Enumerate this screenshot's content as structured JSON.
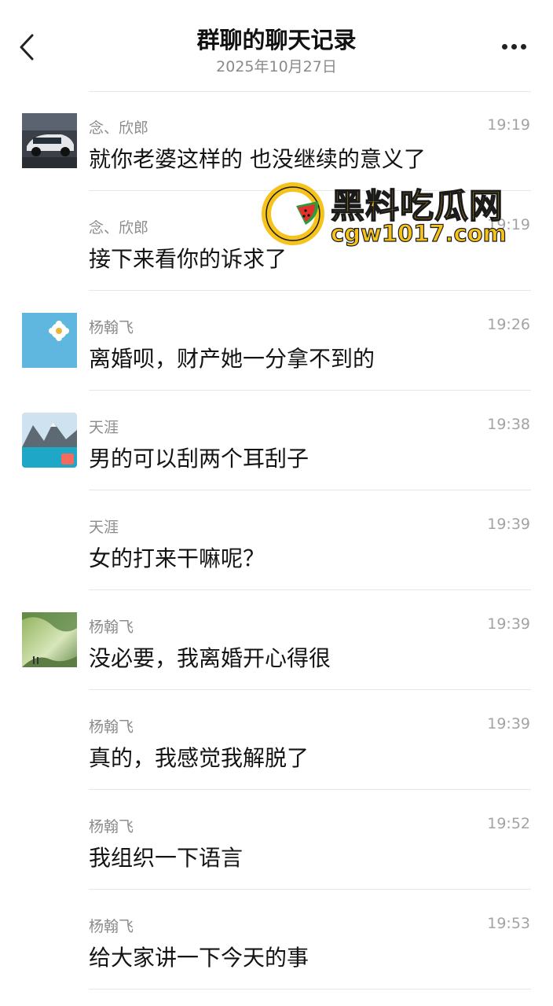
{
  "header": {
    "title": "群聊的聊天记录",
    "subtitle": "2025年10月27日"
  },
  "watermark": {
    "title": "黑料吃瓜网",
    "url": "cgw1017.com"
  },
  "messages": [
    {
      "sender": "念、欣郎",
      "time": "19:19",
      "text": "就你老婆这样的 也没继续的意义了",
      "avatar": "car-photo"
    },
    {
      "sender": "念、欣郎",
      "time": "19:19",
      "text": "接下来看你的诉求了",
      "avatar": ""
    },
    {
      "sender": "杨翰飞",
      "time": "19:26",
      "text": "离婚呗，财产她一分拿不到的",
      "avatar": "blue-flower"
    },
    {
      "sender": "天涯",
      "time": "19:38",
      "text": "男的可以刮两个耳刮子",
      "avatar": "mountain-lake"
    },
    {
      "sender": "天涯",
      "time": "19:39",
      "text": "女的打来干嘛呢？",
      "avatar": ""
    },
    {
      "sender": "杨翰飞",
      "time": "19:39",
      "text": "没必要，我离婚开心得很",
      "avatar": "green-landscape"
    },
    {
      "sender": "杨翰飞",
      "time": "19:39",
      "text": "真的，我感觉我解脱了",
      "avatar": ""
    },
    {
      "sender": "杨翰飞",
      "time": "19:52",
      "text": "我组织一下语言",
      "avatar": ""
    },
    {
      "sender": "杨翰飞",
      "time": "19:53",
      "text": "给大家讲一下今天的事",
      "avatar": ""
    }
  ]
}
